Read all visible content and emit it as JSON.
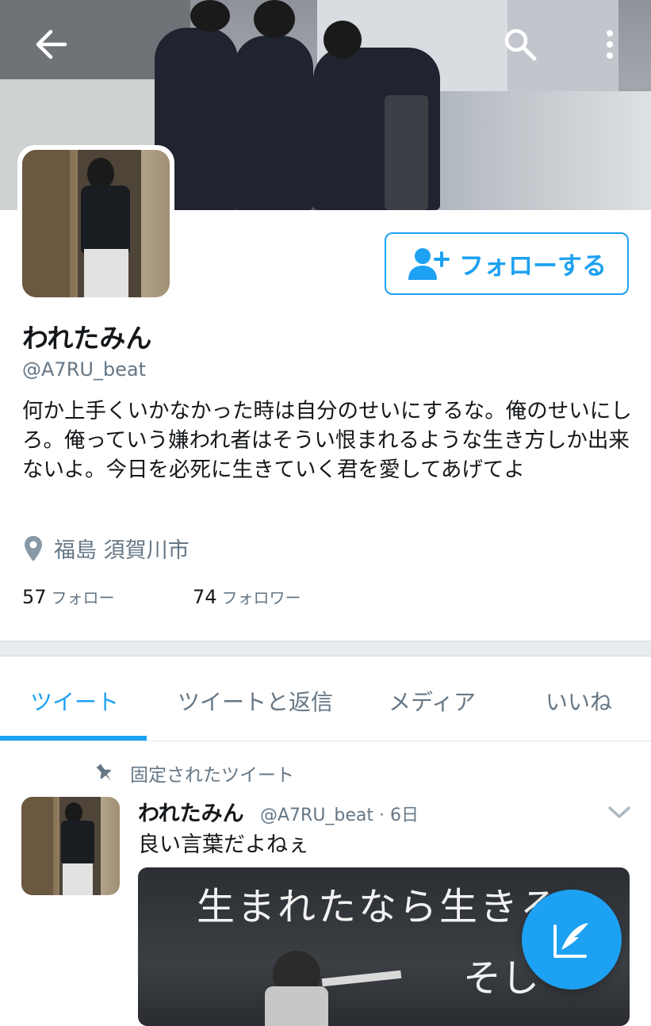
{
  "header": {
    "back_icon": "arrow-left-icon",
    "search_icon": "search-icon",
    "more_icon": "more-vertical-icon"
  },
  "profile": {
    "follow_button_label": "フォローする",
    "display_name": "われたみん",
    "handle": "@A7RU_beat",
    "bio": "何か上手くいかなかった時は自分のせいにするな。俺のせいにしろ。俺っていう嫌われ者はそうい恨まれるような生き方しか出来ないよ。今日を必死に生きていく君を愛してあげてよ",
    "location": "福島 須賀川市",
    "following_count": "57",
    "following_label": "フォロー",
    "followers_count": "74",
    "followers_label": "フォロワー"
  },
  "tabs": [
    {
      "label": "ツイート",
      "active": true
    },
    {
      "label": "ツイートと返信",
      "active": false
    },
    {
      "label": "メディア",
      "active": false
    },
    {
      "label": "いいね",
      "active": false
    }
  ],
  "pinned_tweet": {
    "pinned_label": "固定されたツイート",
    "name": "われたみん",
    "handle_time": "@A7RU_beat · 6日",
    "text": "良い言葉だよねぇ",
    "media_text_line1": "生まれたなら生きろ",
    "media_text_line2": "そし"
  },
  "colors": {
    "accent": "#1da1f2",
    "secondary_text": "#657786"
  }
}
